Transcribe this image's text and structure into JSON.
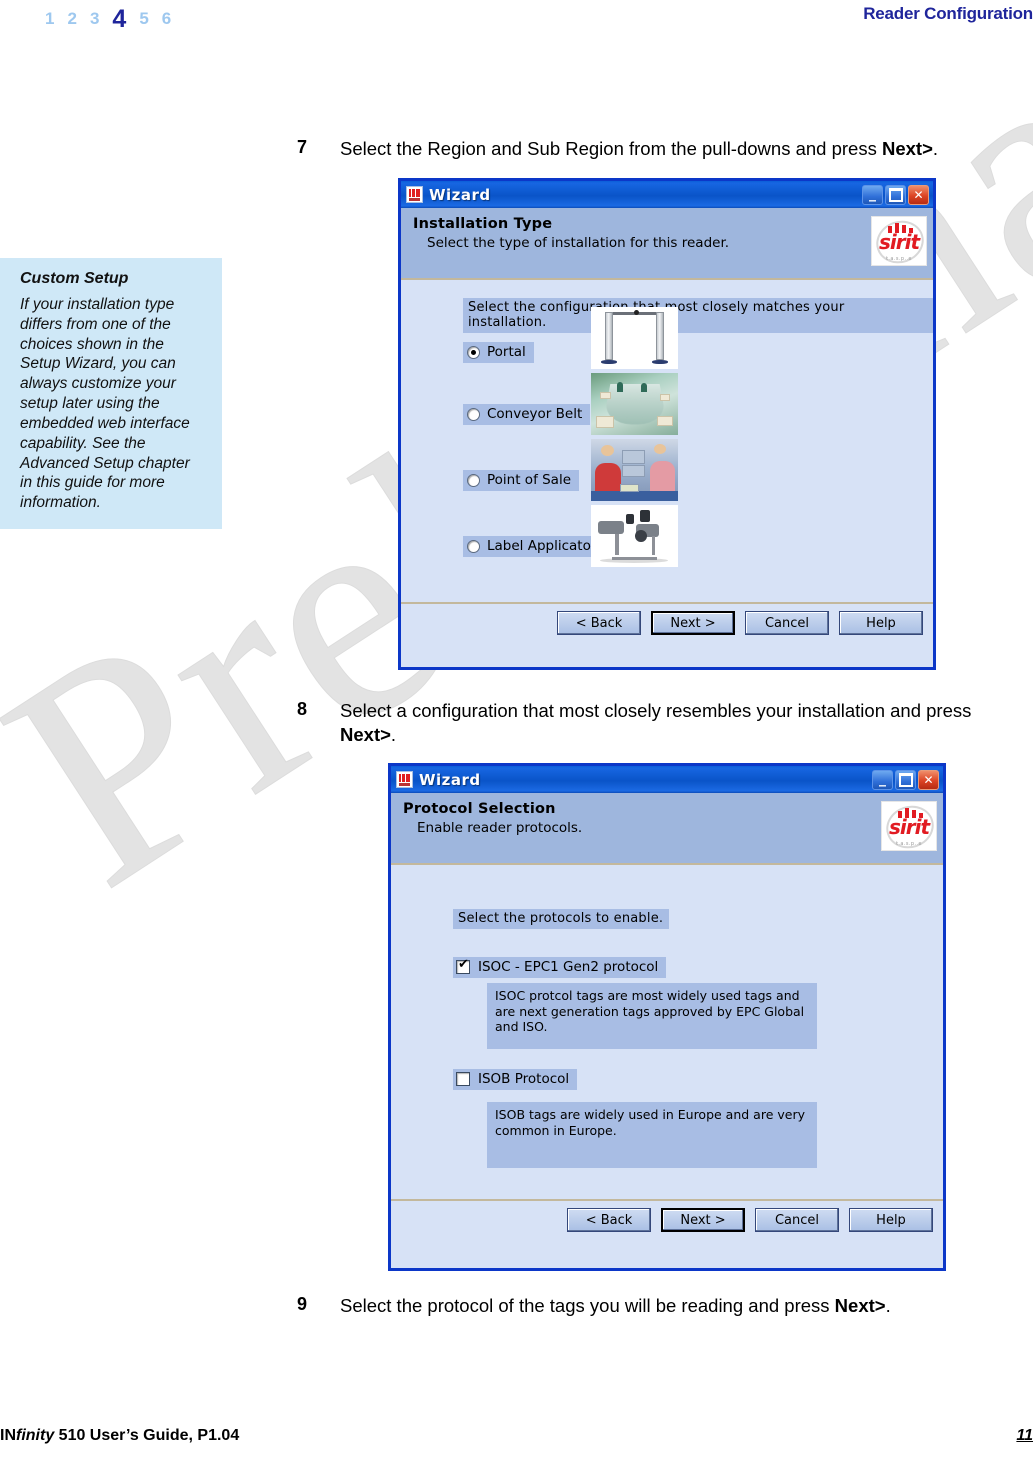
{
  "header": {
    "chapter_numbers": [
      "1",
      "2",
      "3",
      "4",
      "5",
      "6"
    ],
    "current_chapter": "4",
    "title": "Reader Configuration",
    "accent_color": "#1f259b",
    "inactive_color": "#9ec8ef"
  },
  "note": {
    "title": "Custom Setup",
    "body": "If your installation type differs from one of the choices shown in the Setup Wizard, you can always customize your setup later using the embedded web interface capability. See the Advanced Setup chapter in this guide for more information.",
    "background_color": "#cfe8f7"
  },
  "watermark": {
    "text": "Preliminary",
    "color": "#e3e3e3"
  },
  "steps": {
    "step7": {
      "number": "7",
      "text_before": "Select the Region and Sub Region from the pull-downs and press ",
      "bold": "Next>",
      "text_after": "."
    },
    "step8": {
      "number": "8",
      "text_before": "Select a configuration that most closely resembles your installation and press ",
      "bold": "Next>",
      "text_after": "."
    },
    "step9": {
      "number": "9",
      "text_before": "Select the protocol of the tags you will be reading and press ",
      "bold": "Next>",
      "text_after": "."
    }
  },
  "dialog1": {
    "window_title": "Wizard",
    "heading": "Installation Type",
    "subheading": "Select the type of installation for this reader.",
    "logo": {
      "word": "sirit",
      "tagline": "t.a.s.p..e"
    },
    "hint": "Select the configuration that most closely matches your installation.",
    "options": [
      {
        "label": "Portal",
        "selected": true,
        "thumb": "portal-thumbnail"
      },
      {
        "label": "Conveyor Belt",
        "selected": false,
        "thumb": "conveyor-belt-thumbnail"
      },
      {
        "label": "Point of Sale",
        "selected": false,
        "thumb": "point-of-sale-thumbnail"
      },
      {
        "label": "Label Applicator",
        "selected": false,
        "thumb": "label-applicator-thumbnail"
      }
    ],
    "buttons": {
      "back": "< Back",
      "next": "Next >",
      "cancel": "Cancel",
      "help": "Help",
      "default": "Next >"
    },
    "window_controls": {
      "minimize": "_",
      "maximize": "□",
      "close": "✕"
    }
  },
  "dialog2": {
    "window_title": "Wizard",
    "heading": "Protocol Selection",
    "subheading": "Enable reader protocols.",
    "logo": {
      "word": "sirit",
      "tagline": "t.a.s.p..e"
    },
    "hint": "Select the protocols to enable.",
    "protocols": [
      {
        "label": "ISOC - EPC1 Gen2 protocol",
        "checked": true,
        "description": "ISOC protcol tags are most widely used tags and are next generation tags approved by EPC Global and ISO."
      },
      {
        "label": "ISOB Protocol",
        "checked": false,
        "description": "ISOB tags are widely used in Europe and are very common in Europe."
      }
    ],
    "buttons": {
      "back": "< Back",
      "next": "Next >",
      "cancel": "Cancel",
      "help": "Help",
      "default": "Next >"
    },
    "window_controls": {
      "minimize": "_",
      "maximize": "□",
      "close": "✕"
    }
  },
  "footer": {
    "left_prefix": "IN",
    "left_italic": "finity",
    "left_suffix": " 510 User’s Guide, P1.04",
    "page_number": "11"
  }
}
